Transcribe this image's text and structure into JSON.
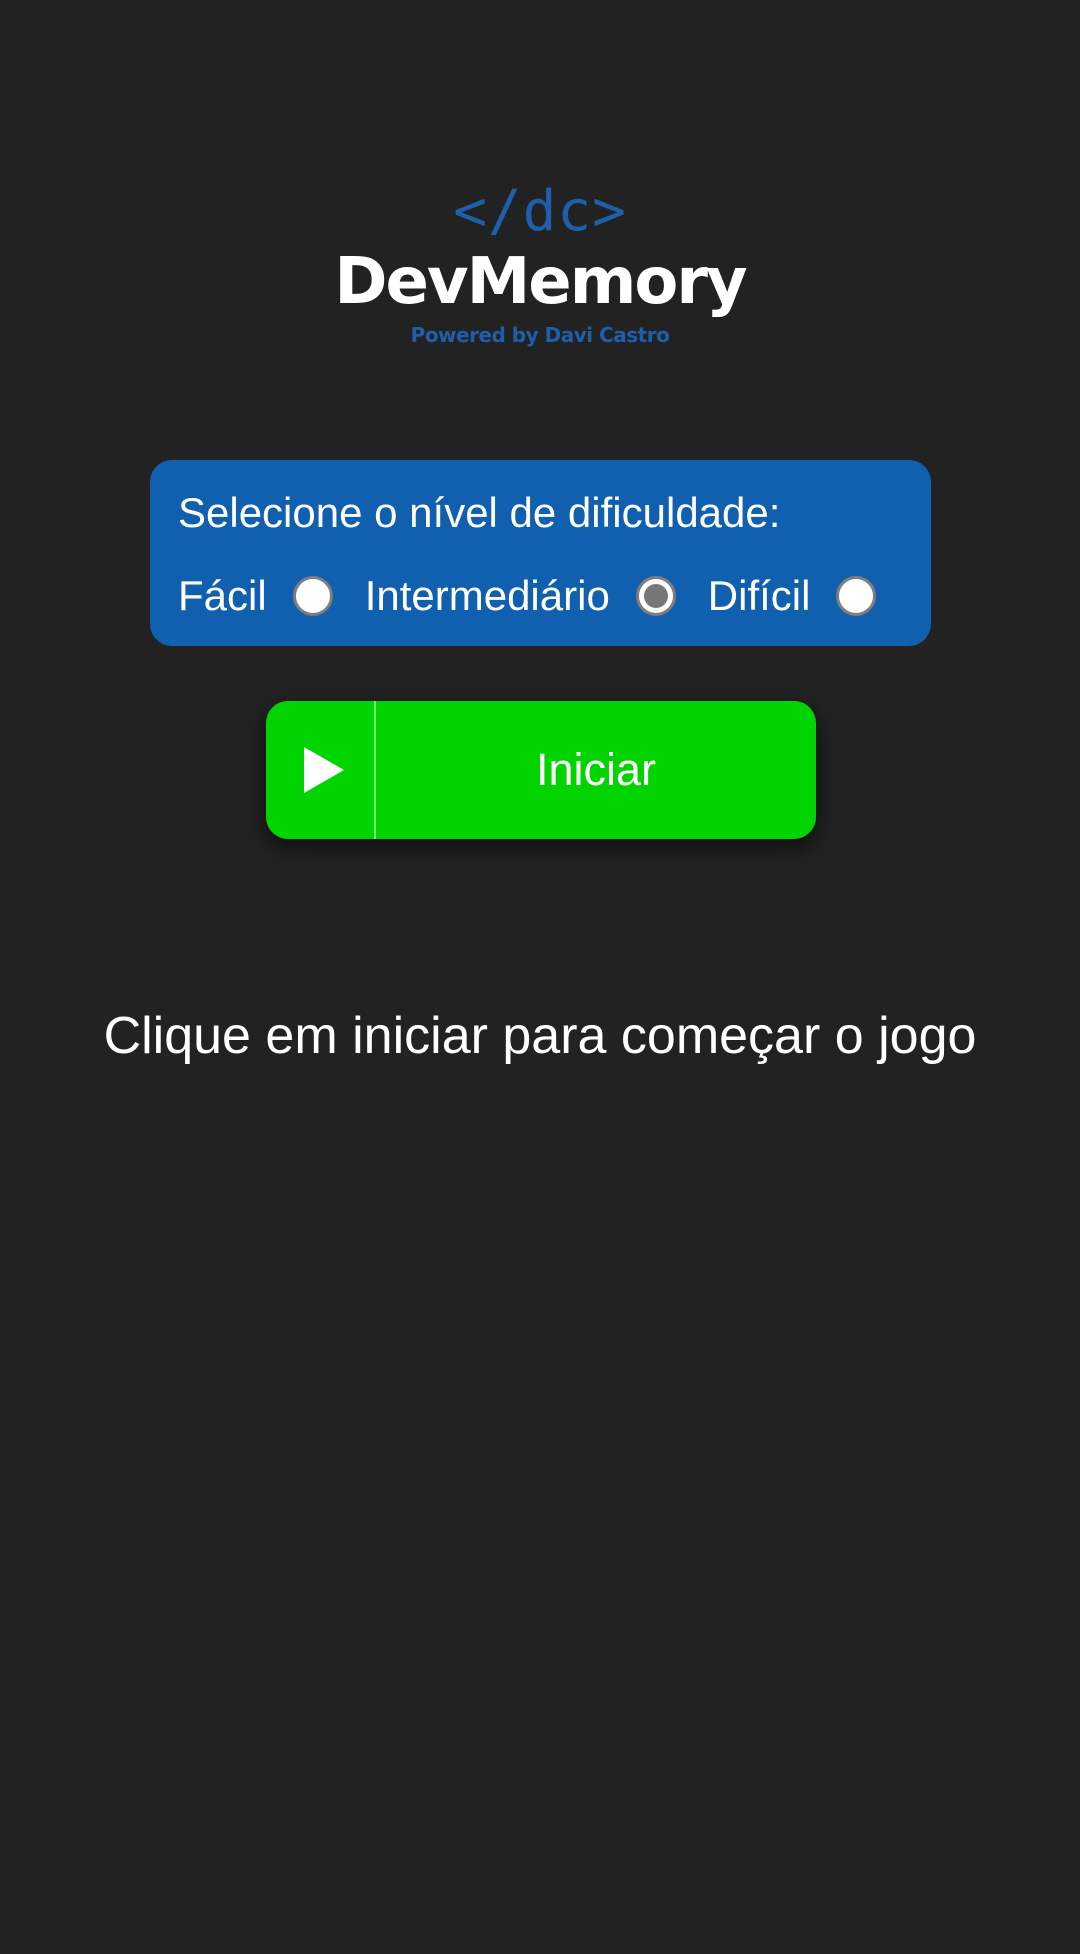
{
  "logo": {
    "mark": "</dc>",
    "name": "DevMemory",
    "subtitle": "Powered by Davi Castro"
  },
  "difficulty": {
    "title": "Selecione o nível de dificuldade:",
    "options": [
      {
        "label": "Fácil",
        "checked": false
      },
      {
        "label": "Intermediário",
        "checked": true
      },
      {
        "label": "Difícil",
        "checked": false
      }
    ],
    "selected": "Intermediário"
  },
  "start_button": {
    "label": "Iniciar",
    "icon": "play-icon"
  },
  "instruction": "Clique em iniciar para começar o jogo",
  "colors": {
    "background": "#222222",
    "panel": "#1160b0",
    "button": "#02d402",
    "logo_accent": "#1e5fab"
  }
}
